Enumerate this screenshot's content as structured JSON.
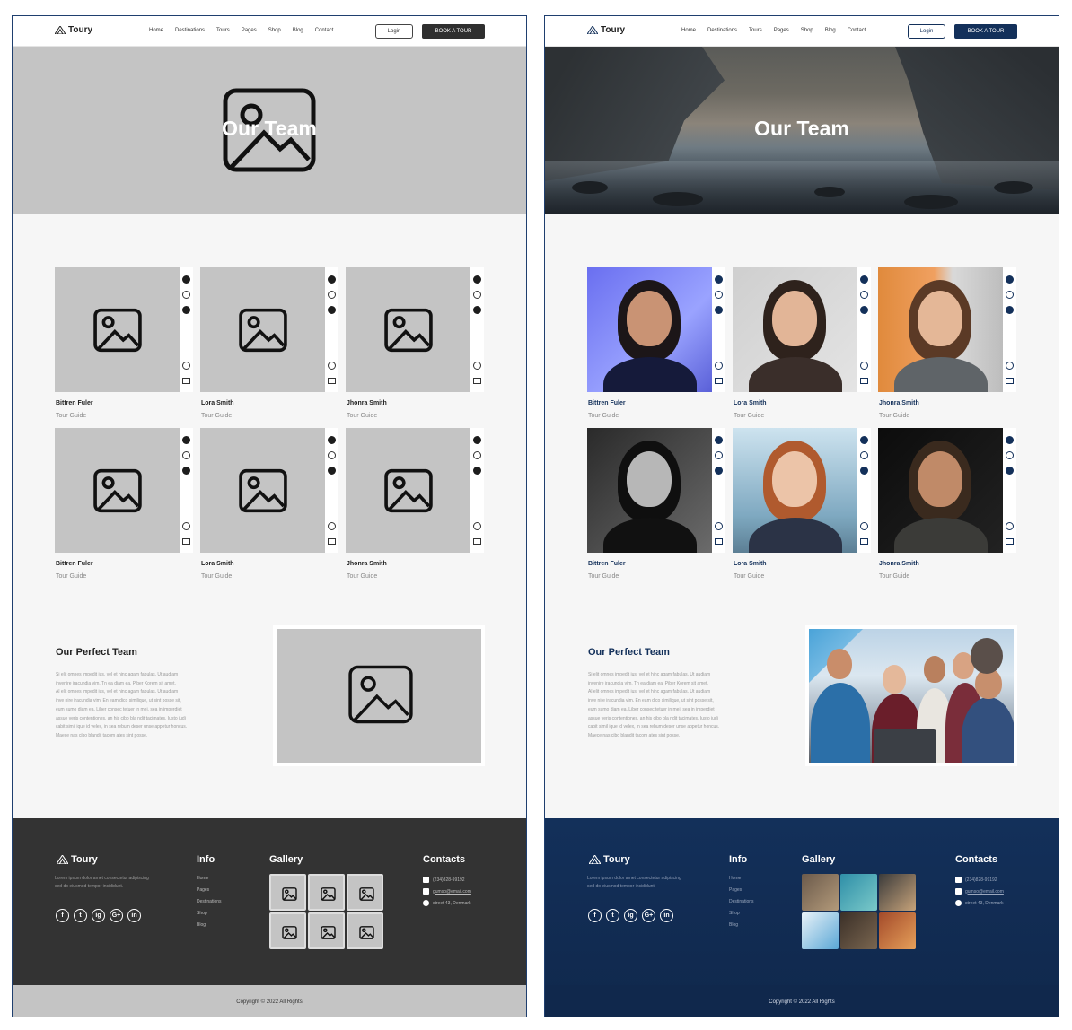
{
  "nav": {
    "logo": "Toury",
    "menu": [
      "Home",
      "Destinations",
      "Tours",
      "Pages",
      "Shop",
      "Blog",
      "Contact"
    ],
    "login": "Login",
    "book": "BOOK A TOUR"
  },
  "hero": {
    "title": "Our Team"
  },
  "team": [
    {
      "name": "Bittren Fuler",
      "role": "Tour Guide"
    },
    {
      "name": "Lora Smith",
      "role": "Tour Guide"
    },
    {
      "name": "Jhonra Smith",
      "role": "Tour Guide"
    },
    {
      "name": "Bittren Fuler",
      "role": "Tour Guide"
    },
    {
      "name": "Lora Smith",
      "role": "Tour Guide"
    },
    {
      "name": "Jhonra Smith",
      "role": "Tour Guide"
    }
  ],
  "perfect": {
    "title": "Our Perfect Team",
    "lines": [
      "Si elit omnes impedit ius, vel et hinc agam fabulas. Ut audiam",
      "invenire iracundia vim. Tn ea diam ea. Piber Korem sit amet.",
      "Al elit omnes impedit ius, vel et hinc agam fabulas. Ut audiam",
      "inve nire iracundia vim. En eam dico similique, ut sint posse sit,",
      "eum sumo diam ea. Liber consec tetuer in mei, sea in imperdiet",
      "assue veris contentiones, an his cibo bla ndit tacimates. Iusto iudi",
      "cabit simil ique id velex, in sea rebum deser unse appetur honcus.",
      "Maece nas cibo blandit tacom ates sint posse."
    ]
  },
  "footer": {
    "logo": "Toury",
    "desc": "Lorem ipsum dolor amet consectetur adipiscing sed do eiusmod tempor incididunt.",
    "social": [
      "f",
      "t",
      "ig",
      "G+",
      "in"
    ],
    "info_title": "Info",
    "info": [
      "Home",
      "Pages",
      "Destinations",
      "Shop",
      "Blog"
    ],
    "gallery_title": "Gallery",
    "contacts_title": "Contacts",
    "phone": "(234)828-99192",
    "email": "gumso@email.com",
    "address": "street 43, Denmark",
    "copyright": "Copyright © 2022 All Rights"
  }
}
